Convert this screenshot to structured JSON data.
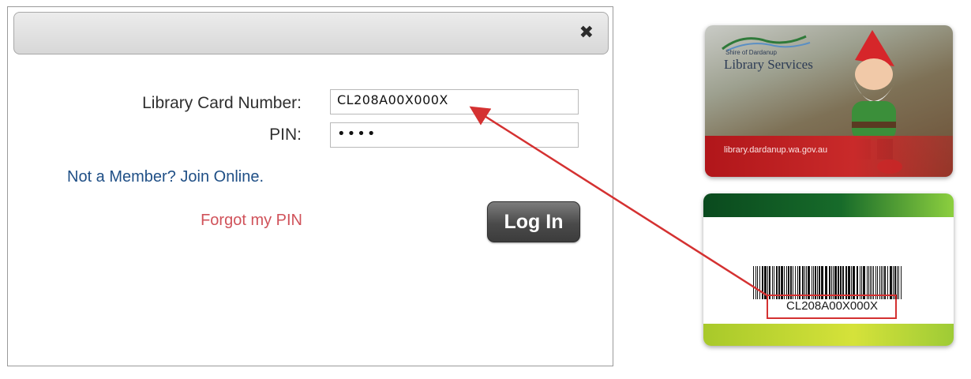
{
  "dialog": {
    "close_glyph": "✖",
    "card_number_label": "Library Card Number:",
    "card_number_value": "CL208A00X000X",
    "pin_label": "PIN:",
    "pin_value": "••••",
    "join_link": "Not a Member? Join Online.",
    "forgot_link": "Forgot my PIN",
    "login_button": "Log In"
  },
  "card_front": {
    "shire": "Shire of Dardanup",
    "title": "Library Services",
    "url": "library.dardanup.wa.gov.au"
  },
  "card_back": {
    "barcode_number": "CL208A00X000X"
  },
  "annotation": {
    "color": "#d43131"
  }
}
